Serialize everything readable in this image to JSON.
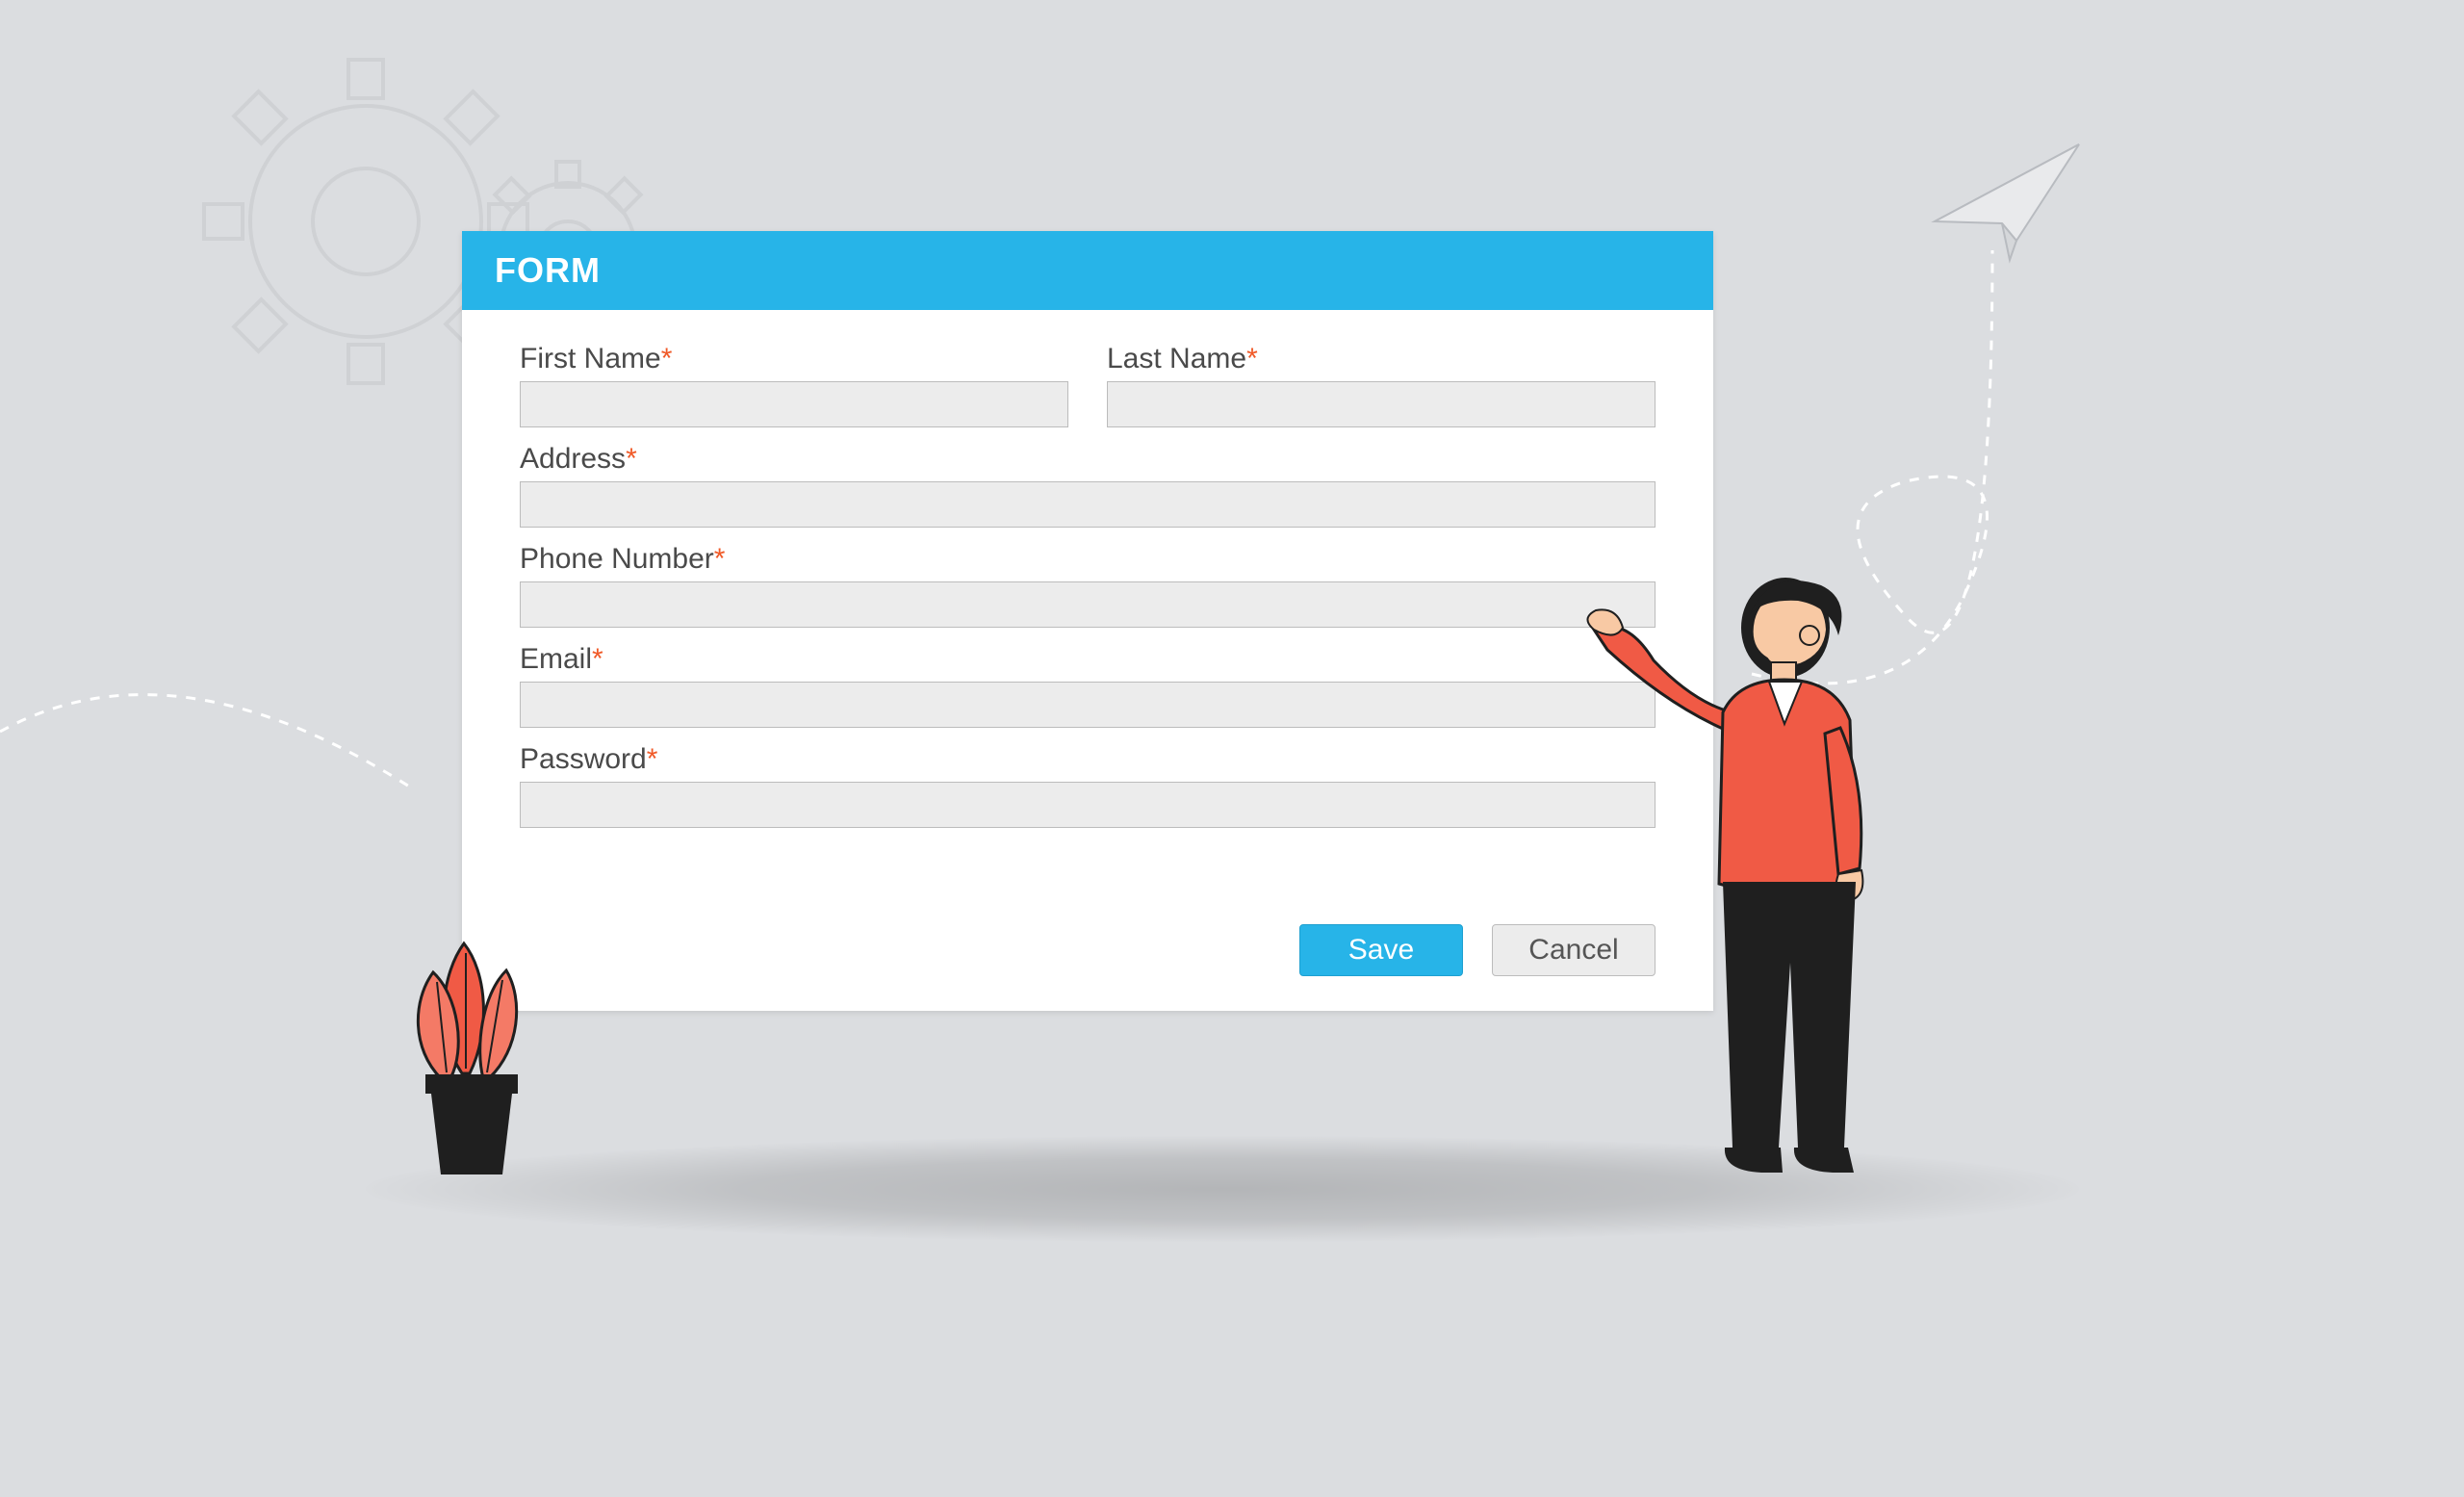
{
  "header": {
    "title": "FORM"
  },
  "fields": {
    "first_name": {
      "label": "First Name",
      "required": true,
      "value": ""
    },
    "last_name": {
      "label": "Last Name",
      "required": true,
      "value": ""
    },
    "address": {
      "label": "Address",
      "required": true,
      "value": ""
    },
    "phone": {
      "label": "Phone Number",
      "required": true,
      "value": ""
    },
    "email": {
      "label": "Email",
      "required": true,
      "value": ""
    },
    "password": {
      "label": "Password",
      "required": true,
      "value": ""
    }
  },
  "actions": {
    "save_label": "Save",
    "cancel_label": "Cancel"
  },
  "required_marker": "*",
  "colors": {
    "accent": "#27b4e8",
    "required": "#f05a28",
    "person_shirt": "#f05a45",
    "plant": "#f05a45"
  },
  "icons": {
    "gear_large": "gear-icon",
    "gear_small": "gear-icon",
    "paper_plane": "paper-plane-icon",
    "plant": "plant-icon",
    "person": "person-illustration"
  }
}
